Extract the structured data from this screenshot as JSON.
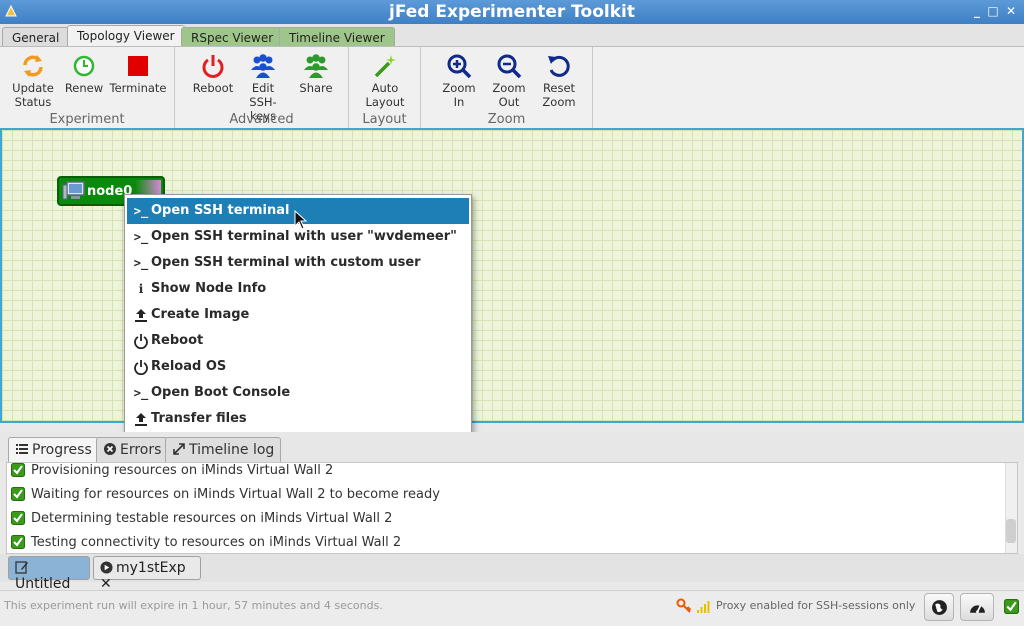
{
  "window": {
    "title": "jFed Experimenter Toolkit"
  },
  "tabs": [
    {
      "label": "General"
    },
    {
      "label": "Topology Viewer"
    },
    {
      "label": "RSpec Viewer"
    },
    {
      "label": "Timeline Viewer"
    }
  ],
  "ribbon": {
    "groups": {
      "experiment": "Experiment",
      "advanced": "Advanced",
      "layout": "Layout",
      "zoom": "Zoom"
    },
    "buttons": {
      "update_status": [
        "Update",
        "Status"
      ],
      "renew": "Renew",
      "terminate": "Terminate",
      "reboot": "Reboot",
      "edit_ssh": [
        "Edit",
        "SSH-keys"
      ],
      "share": "Share",
      "auto_layout": [
        "Auto",
        "Layout"
      ],
      "zoom_in": [
        "Zoom",
        "In"
      ],
      "zoom_out": [
        "Zoom",
        "Out"
      ],
      "reset_zoom": [
        "Reset",
        "Zoom"
      ]
    }
  },
  "canvas": {
    "node_label": "node0"
  },
  "context_menu": [
    {
      "label": "Open SSH terminal",
      "icon": "terminal-icon",
      "glyph": ">_"
    },
    {
      "label": "Open SSH terminal with user \"wvdemeer\"",
      "icon": "terminal-icon",
      "glyph": ">_"
    },
    {
      "label": "Open SSH terminal with custom user",
      "icon": "terminal-icon",
      "glyph": ">_"
    },
    {
      "label": "Show Node Info",
      "icon": "info-icon",
      "glyph": "i"
    },
    {
      "label": "Create Image",
      "icon": "upload-icon",
      "glyph": ""
    },
    {
      "label": "Reboot",
      "icon": "power-icon",
      "glyph": ""
    },
    {
      "label": "Reload OS",
      "icon": "power-icon",
      "glyph": ""
    },
    {
      "label": "Open Boot Console",
      "icon": "terminal-icon",
      "glyph": ">_"
    },
    {
      "label": "Transfer files",
      "icon": "upload-icon",
      "glyph": ""
    }
  ],
  "bottom_tabs": [
    {
      "label": "Progress",
      "icon": "list-icon"
    },
    {
      "label": "Errors",
      "icon": "error-icon"
    },
    {
      "label": "Timeline log",
      "icon": "expand-icon"
    }
  ],
  "progress": [
    "Provisioning resources on iMinds Virtual Wall 2",
    "Waiting for resources on iMinds Virtual Wall 2 to become ready",
    "Determining testable resources on iMinds Virtual Wall 2",
    "Testing connectivity to resources on iMinds Virtual Wall 2"
  ],
  "experiment_tabs": [
    {
      "label": "Untitled"
    },
    {
      "label": "my1stExp",
      "close": "✕"
    }
  ],
  "status": {
    "expiry": "This experiment run will expire in 1 hour, 57 minutes and 4 seconds.",
    "proxy": "Proxy enabled for SSH-sessions only"
  },
  "colors": {
    "accent": "#1d7fb6",
    "node": "#0a8a0a",
    "terminate": "#e00000",
    "reboot": "#e02020",
    "users": "#1a4fd0",
    "share": "#2e9a2e"
  }
}
